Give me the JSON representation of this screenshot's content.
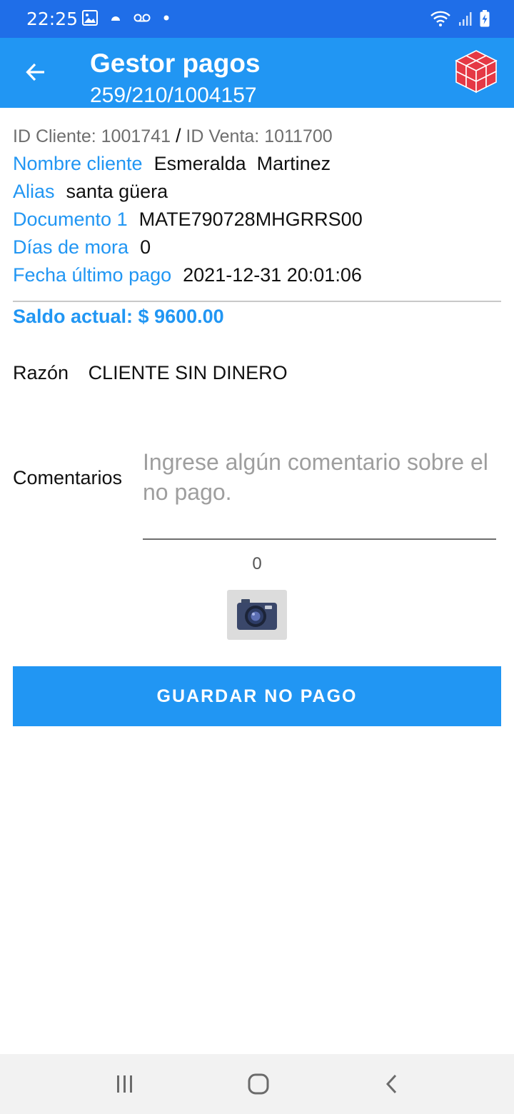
{
  "status_bar": {
    "time": "22:25",
    "left_icons": [
      "image-icon",
      "android-icon",
      "voicemail-icon",
      "dot-icon"
    ],
    "right_icons": [
      "wifi-icon",
      "signal-icon",
      "battery-charging-icon"
    ]
  },
  "app_bar": {
    "title": "Gestor pagos",
    "subtitle": "259/210/1004157",
    "back_icon": "arrow-back-icon",
    "logo_icon": "cube-logo-icon",
    "logo_color": "#e53945"
  },
  "client": {
    "id_cliente": "ID Cliente: 1001741",
    "separator": "/",
    "id_venta": "ID Venta: 1011700",
    "nombre_label": "Nombre cliente",
    "nombre_value": "Esmeralda  Martinez",
    "alias_label": "Alias",
    "alias_value": "santa güera",
    "documento_label": "Documento 1",
    "documento_value": "MATE790728MHGRRS00",
    "mora_label": "Días de mora",
    "mora_value": "0",
    "fecha_label": "Fecha último pago",
    "fecha_value": "2021-12-31 20:01:06",
    "saldo": "Saldo actual: $ 9600.00"
  },
  "form": {
    "razon_label": "Razón",
    "razon_value": "CLIENTE SIN DINERO",
    "comentarios_label": "Comentarios",
    "comentarios_value": "",
    "comentarios_placeholder": "Ingrese algún comentario sobre el no pago.",
    "char_count": "0",
    "camera_icon": "camera-icon",
    "save_label": "GUARDAR NO PAGO"
  },
  "nav_bar": {
    "buttons": [
      "recent-apps-icon",
      "home-icon",
      "back-icon"
    ]
  },
  "colors": {
    "status_bar": "#1f6ee8",
    "primary": "#2196f3",
    "nav_bar": "#f2f2f2"
  }
}
